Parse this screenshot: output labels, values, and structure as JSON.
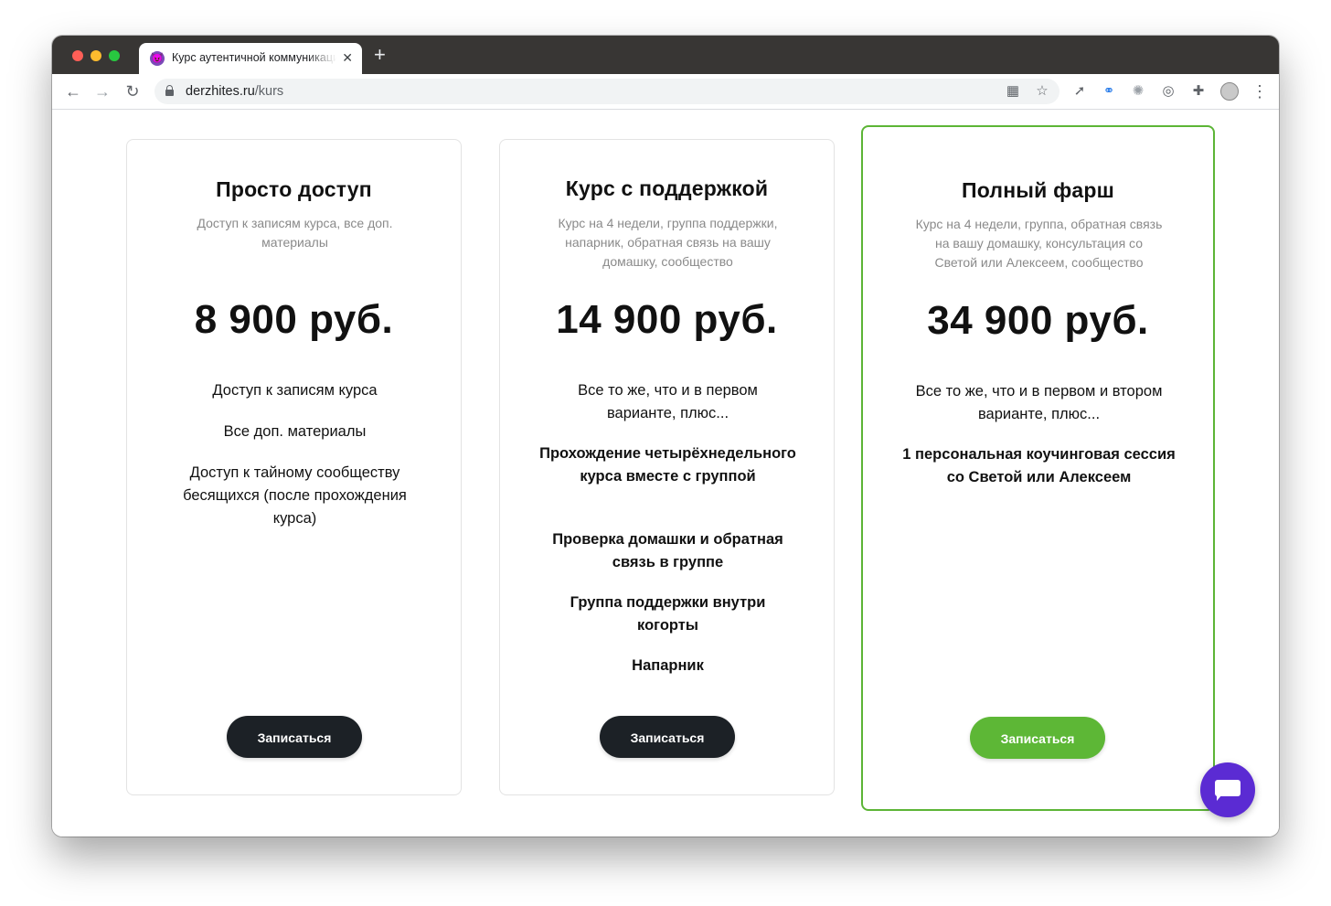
{
  "browser": {
    "tab_title": "Курс аутентичной коммуникации",
    "tab_favicon": "😈",
    "tab_close": "✕",
    "new_tab": "+",
    "url_host": "derzhites.ru",
    "url_path": "/kurs",
    "nav": {
      "back": "←",
      "forward": "→",
      "reload": "↻",
      "menu": "⋮"
    },
    "omnibox_icons": [
      "qr-code-icon",
      "star-icon"
    ],
    "extensions": [
      "rocket-icon",
      "link-icon",
      "globe-icon",
      "target-icon",
      "puzzle-icon"
    ]
  },
  "plans": [
    {
      "title": "Просто доступ",
      "description": "Доступ к записям курса, все доп. материалы",
      "price": "8 900 руб.",
      "features": [
        {
          "text": "Доступ к записям курса",
          "bold": false
        },
        {
          "text": "Все доп. материалы",
          "bold": false
        },
        {
          "text": "Доступ к тайному сообществу бесящихся (после прохождения курса)",
          "bold": false
        }
      ],
      "button": "Записаться"
    },
    {
      "title": "Курс с поддержкой",
      "description": "Курс на 4 недели, группа поддержки, напарник, обратная связь на вашу домашку, сообщество",
      "price": "14 900 руб.",
      "features": [
        {
          "text": "Все то же, что и в первом варианте, плюс...",
          "bold": false
        },
        {
          "text": "Прохождение четырёхнедельного курса вместе с группой",
          "bold": true
        },
        {
          "text": "Проверка домашки и обратная связь в группе",
          "bold": true
        },
        {
          "text": "Группа поддержки внутри когорты",
          "bold": true
        },
        {
          "text": "Напарник",
          "bold": true
        }
      ],
      "button": "Записаться"
    },
    {
      "title": "Полный фарш",
      "description": "Курс на 4 недели, группа, обратная связь на вашу домашку, консультация со Светой или Алексеем, сообщество",
      "price": "34 900 руб.",
      "features": [
        {
          "text": "Все то же, что и в первом и втором варианте, плюс...",
          "bold": false
        },
        {
          "text": "1 персональная коучинговая сессия со Светой или Алексеем",
          "bold": true
        }
      ],
      "button": "Записаться",
      "accent": "#5cb536"
    }
  ],
  "colors": {
    "dark_button": "#1c2126",
    "green_button": "#5db736",
    "chat_widget": "#5b2bd3"
  },
  "chat_widget_icon": "chat-bubble-icon"
}
